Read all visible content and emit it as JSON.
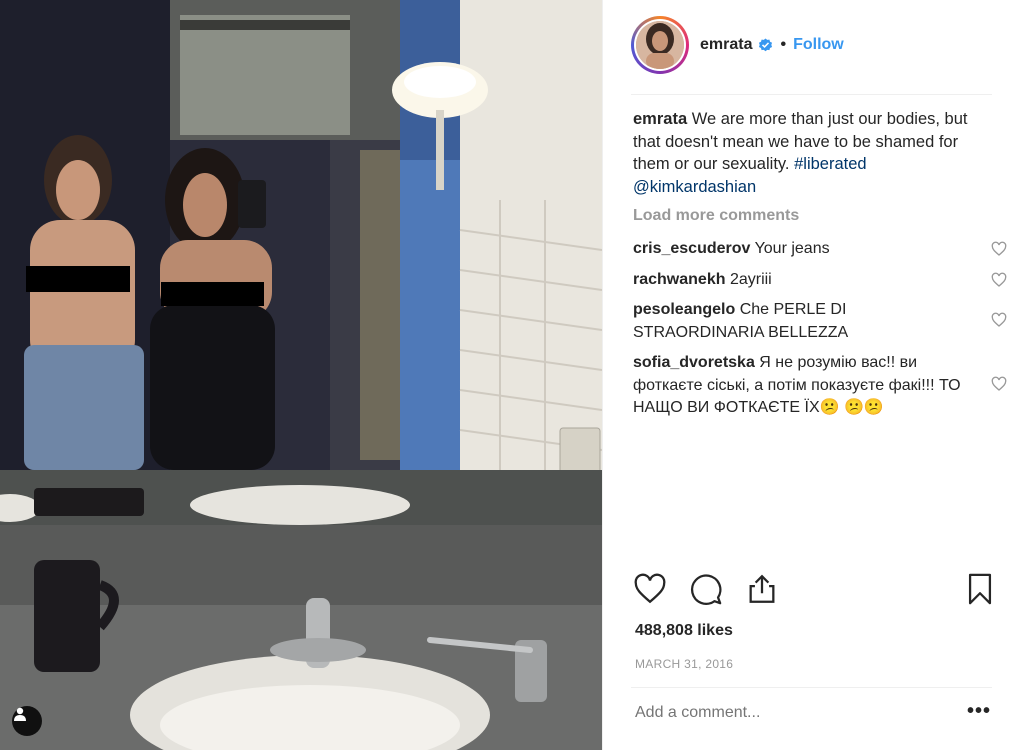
{
  "post": {
    "username": "emrata",
    "follow_label": "Follow",
    "caption_username": "emrata",
    "caption_text": "We are more than just our bodies, but that doesn't mean we have to be shamed for them or our sexuality.",
    "caption_hashtag": "#liberated",
    "caption_mention": "@kimkardashian",
    "load_more_label": "Load more comments",
    "likes": "488,808 likes",
    "date": "MARCH 31, 2016",
    "add_comment_placeholder": "Add a comment...",
    "more_label": "•••"
  },
  "comments": [
    {
      "user": "cris_escuderov",
      "text": "Your jeans"
    },
    {
      "user": "rachwanekh",
      "text": "2ayriii"
    },
    {
      "user": "pesoleangelo",
      "text": "Che PERLE DI STRAORDINARIA BELLEZZA"
    },
    {
      "user": "sofia_dvoretska",
      "text": "Я не розумію вас!! ви фоткаєте сіські, а потім показуєте факі!!! ТО НАЩО ВИ ФОТКАЄТЕ ЇХ😕 😕😕"
    }
  ],
  "icons": {
    "verified": "verified-badge-icon",
    "heart": "heart-icon",
    "comment": "comment-bubble-icon",
    "share": "share-icon",
    "save": "bookmark-icon",
    "tag": "user-tag-icon"
  },
  "colors": {
    "follow": "#3897f0",
    "link": "#003569",
    "muted": "#999999"
  }
}
